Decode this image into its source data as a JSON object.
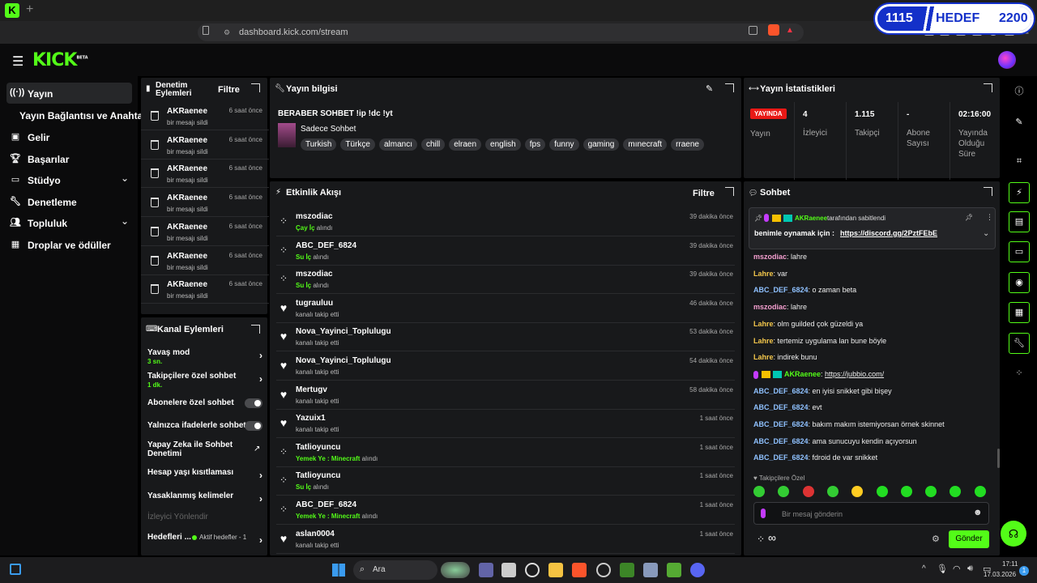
{
  "browser": {
    "url": "dashboard.kick.com/stream",
    "new_tab": "+"
  },
  "score_overlay": {
    "left": "1115",
    "center": "HEDEF",
    "right": "2200"
  },
  "header": {
    "logo": "KICK",
    "logo_sup": "BETA"
  },
  "sidebar": {
    "items": [
      {
        "label": "Yayın",
        "icon": "broadcast-icon"
      },
      {
        "label": "Yayın Bağlantısı ve Anahtarı"
      },
      {
        "label": "Gelir",
        "icon": "dollar-icon"
      },
      {
        "label": "Başarılar",
        "icon": "trophy-icon"
      },
      {
        "label": "Stüdyo",
        "icon": "studio-icon"
      },
      {
        "label": "Denetleme",
        "icon": "wrench-icon"
      },
      {
        "label": "Topluluk",
        "icon": "people-icon"
      },
      {
        "label": "Droplar ve ödüller",
        "icon": "drops-icon"
      }
    ]
  },
  "modlog": {
    "title": "Denetim Eylemleri",
    "filter": "Filtre",
    "entries": [
      {
        "user": "AKRaenee",
        "time": "6 saat önce",
        "action": "bir mesajı sildi"
      },
      {
        "user": "AKRaenee",
        "time": "6 saat önce",
        "action": "bir mesajı sildi"
      },
      {
        "user": "AKRaenee",
        "time": "6 saat önce",
        "action": "bir mesajı sildi"
      },
      {
        "user": "AKRaenee",
        "time": "6 saat önce",
        "action": "bir mesajı sildi"
      },
      {
        "user": "AKRaenee",
        "time": "6 saat önce",
        "action": "bir mesajı sildi"
      },
      {
        "user": "AKRaenee",
        "time": "6 saat önce",
        "action": "bir mesajı sildi"
      },
      {
        "user": "AKRaenee",
        "time": "6 saat önce",
        "action": "bir mesajı sildi"
      }
    ]
  },
  "channel_actions": {
    "title": "Kanal Eylemleri",
    "slow_mode": {
      "label": "Yavaş mod",
      "value": "3 sn."
    },
    "followers_only": {
      "label": "Takipçilere özel sohbet",
      "value": "1 dk."
    },
    "subs_only": "Abonelere özel sohbet",
    "emotes_only": "Yalnızca ifadelerle sohbet",
    "ai_mod": "Yapay Zeka ile Sohbet Denetimi",
    "age_restriction": "Hesap yaşı kısıtlaması",
    "banned_words": "Yasaklanmış kelimeler",
    "viewer_redirect": "İzleyici Yönlendir",
    "goals": "Hedefleri ...",
    "goals_status": "Aktif hedefler - 1"
  },
  "stream_info": {
    "title_label": "Yayın bilgisi",
    "stream_title": "BERABER SOHBET !ip !dc !yt",
    "category": "Sadece Sohbet",
    "tags": [
      "Turkish",
      "Türkçe",
      "almancı",
      "chill",
      "elraen",
      "english",
      "fps",
      "funny",
      "gaming",
      "mınecraft",
      "rraene"
    ]
  },
  "activity": {
    "title": "Etkinlik Akışı",
    "filter": "Filtre",
    "events": [
      {
        "user": "mszodiac",
        "highlight": "Çay İç",
        "text": " alındı",
        "time": "39 dakika önce",
        "type": "redeem"
      },
      {
        "user": "ABC_DEF_6824",
        "highlight": "Su İç",
        "text": " alındı",
        "time": "39 dakika önce",
        "type": "redeem"
      },
      {
        "user": "mszodiac",
        "highlight": "Su İç",
        "text": " alındı",
        "time": "39 dakika önce",
        "type": "redeem"
      },
      {
        "user": "tugrauluu",
        "highlight": "",
        "text": "kanalı takip etti",
        "time": "46 dakika önce",
        "type": "follow"
      },
      {
        "user": "Nova_Yayinci_Toplulugu",
        "highlight": "",
        "text": "kanalı takip etti",
        "time": "53 dakika önce",
        "type": "follow"
      },
      {
        "user": "Nova_Yayinci_Toplulugu",
        "highlight": "",
        "text": "kanalı takip etti",
        "time": "54 dakika önce",
        "type": "follow"
      },
      {
        "user": "Mertugv",
        "highlight": "",
        "text": "kanalı takip etti",
        "time": "58 dakika önce",
        "type": "follow"
      },
      {
        "user": "Yazuix1",
        "highlight": "",
        "text": "kanalı takip etti",
        "time": "1 saat önce",
        "type": "follow"
      },
      {
        "user": "Tatlioyuncu",
        "highlight": "Yemek Ye : Minecraft",
        "text": " alındı",
        "time": "1 saat önce",
        "type": "redeem"
      },
      {
        "user": "Tatlioyuncu",
        "highlight": "Su İç",
        "text": " alındı",
        "time": "1 saat önce",
        "type": "redeem"
      },
      {
        "user": "ABC_DEF_6824",
        "highlight": "Yemek Ye : Minecraft",
        "text": " alındı",
        "time": "1 saat önce",
        "type": "redeem"
      },
      {
        "user": "aslan0004",
        "highlight": "",
        "text": "kanalı takip etti",
        "time": "1 saat önce",
        "type": "follow"
      }
    ]
  },
  "stats": {
    "title": "Yayın İstatistikleri",
    "live_badge": "YAYINDA",
    "live_label": "Yayın",
    "items": [
      {
        "value": "4",
        "label": "İzleyici"
      },
      {
        "value": "1.115",
        "label": "Takipçi"
      },
      {
        "value": "-",
        "label": "Abone Sayısı"
      },
      {
        "value": "02:16:00",
        "label": "Yayında Olduğu Süre"
      }
    ]
  },
  "chat": {
    "title": "Sohbet",
    "pinned_by": "AKRaenee",
    "pinned_suffix": " tarafından sabitlendi",
    "pinned_text": "benimle oynamak için : ",
    "pinned_link": "https://discord.gg/2PztFEbE",
    "messages": [
      {
        "user": "mszodiac",
        "text": "lahre",
        "color": "#f59fd0"
      },
      {
        "user": "Lahre",
        "text": "var",
        "color": "#f5c84c"
      },
      {
        "user": "ABC_DEF_6824",
        "text": "o zaman beta",
        "color": "#8fc1ff"
      },
      {
        "user": "mszodiac",
        "text": "lahre",
        "color": "#f59fd0"
      },
      {
        "user": "Lahre",
        "text": "olm guilded çok güzeldi ya",
        "color": "#f5c84c"
      },
      {
        "user": "Lahre",
        "text": "tertemiz uygulama lan bune böyle",
        "color": "#f5c84c"
      },
      {
        "user": "Lahre",
        "text": "indirek bunu",
        "color": "#f5c84c"
      },
      {
        "user": "AKRaenee",
        "text": "https://jubbio.com/",
        "color": "#53fc18",
        "badges": true
      },
      {
        "user": "ABC_DEF_6824",
        "text": "en iyisi snikket gibi bişey",
        "color": "#8fc1ff"
      },
      {
        "user": "ABC_DEF_6824",
        "text": "evt",
        "color": "#8fc1ff"
      },
      {
        "user": "ABC_DEF_6824",
        "text": "bakım makım istemiyorsan örnek skinnet",
        "color": "#8fc1ff"
      },
      {
        "user": "ABC_DEF_6824",
        "text": "ama sunucuyu kendin açıyorsun",
        "color": "#8fc1ff"
      },
      {
        "user": "ABC_DEF_6824",
        "text": "fdroid de var snikket",
        "color": "#8fc1ff"
      }
    ],
    "emote_section": "Takipçilere Özel",
    "input_placeholder": "Bir mesaj gönderin",
    "send": "Gönder"
  },
  "taskbar": {
    "search": "Ara",
    "time": "17:11",
    "date": "17.03.2026",
    "notifications": "1"
  },
  "colors": {
    "kick_green": "#53fc18",
    "panel": "#18191b",
    "live_red": "#e91916"
  }
}
